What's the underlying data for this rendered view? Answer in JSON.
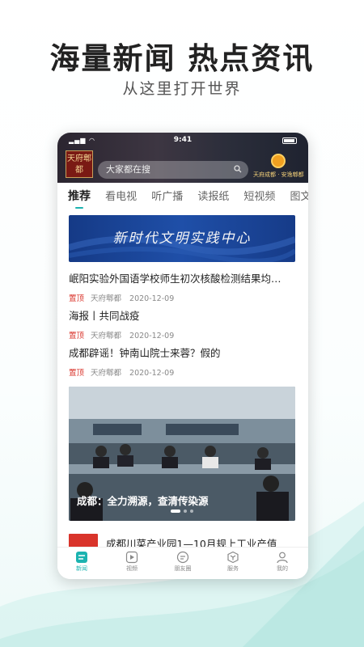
{
  "promo": {
    "headline": "海量新闻 热点资讯",
    "subline": "从这里打开世界"
  },
  "status_bar": {
    "time": "9:41"
  },
  "header": {
    "logo_left_text": "天府郫都",
    "search_placeholder": "大家都在搜",
    "logo_right_caption": "天府成都 · 安逸郫都"
  },
  "tabs": [
    {
      "label": "推荐",
      "active": true
    },
    {
      "label": "看电视"
    },
    {
      "label": "听广播"
    },
    {
      "label": "读报纸"
    },
    {
      "label": "短视频"
    },
    {
      "label": "图文"
    }
  ],
  "hero_banner": {
    "text": "新时代文明实践中心"
  },
  "news": [
    {
      "title": "岷阳实验外国语学校师生初次核酸检测结果均…",
      "pin": "置顶",
      "source": "天府郫都",
      "date": "2020-12-09"
    },
    {
      "title": "海报丨共同战疫",
      "pin": "置顶",
      "source": "天府郫都",
      "date": "2020-12-09"
    },
    {
      "title": "成都辟谣！钟南山院士来蓉？假的",
      "pin": "置顶",
      "source": "天府郫都",
      "date": "2020-12-09"
    }
  ],
  "photo_card": {
    "caption": "成都：全力溯源，查清传染源"
  },
  "last_item": {
    "title": "成都川菜产业园1—10月规上工业产值"
  },
  "bottom_nav": [
    {
      "label": "新闻",
      "icon": "news-icon",
      "active": true
    },
    {
      "label": "视频",
      "icon": "video-icon"
    },
    {
      "label": "朋友圈",
      "icon": "chat-icon"
    },
    {
      "label": "服务",
      "icon": "service-icon"
    },
    {
      "label": "我的",
      "icon": "user-icon"
    }
  ],
  "colors": {
    "accent": "#1bb3b0",
    "pin": "#d9342b",
    "hero": "#1f4fa8"
  }
}
